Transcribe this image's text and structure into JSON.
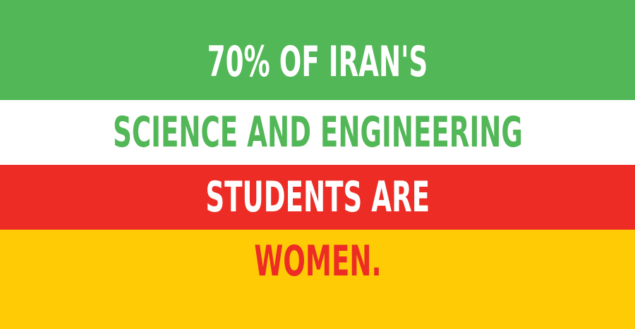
{
  "colors": {
    "green": "#52b757",
    "white": "#ffffff",
    "red": "#ec2c25",
    "yellow": "#fecb05"
  },
  "lines": [
    {
      "text": "70% OF IRAN'S",
      "band_color": "#52b757",
      "text_color": "#ffffff"
    },
    {
      "text": "SCIENCE AND ENGINEERING",
      "band_color": "#ffffff",
      "text_color": "#52b757"
    },
    {
      "text": "STUDENTS ARE",
      "band_color": "#ec2c25",
      "text_color": "#ffffff"
    },
    {
      "text": "WOMEN.",
      "band_color": "#fecb05",
      "text_color": "#ec2c25"
    }
  ]
}
